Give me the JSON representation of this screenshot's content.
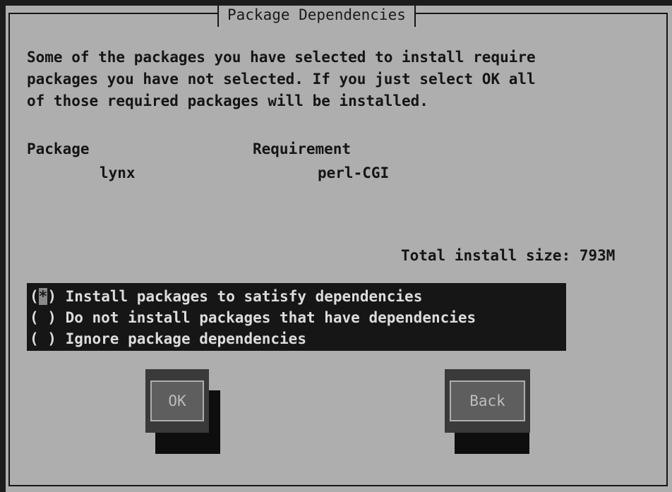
{
  "dialog": {
    "title": "Package Dependencies",
    "intro": "Some of the packages you have selected to install require\npackages you have not selected. If you just select OK all\nof those required packages will be installed.",
    "columns": {
      "package": "Package",
      "requirement": "Requirement"
    },
    "rows": [
      {
        "package": "lynx",
        "requirement": "perl-CGI"
      }
    ],
    "total_install_size": "Total install size: 793M",
    "options": [
      {
        "mark": "(*)",
        "label": "Install packages to satisfy dependencies",
        "selected": true
      },
      {
        "mark": "( )",
        "label": "Do not install packages that have dependencies",
        "selected": false
      },
      {
        "mark": "( )",
        "label": "Ignore package dependencies",
        "selected": false
      }
    ],
    "buttons": {
      "ok": "OK",
      "back": "Back"
    }
  },
  "colors": {
    "dialog_bg": "#aeaeae",
    "screen_bg": "#1c1c1c",
    "list_bg": "#161616",
    "list_text": "#dcdcdc",
    "button_bg": "#3a3a3a"
  }
}
